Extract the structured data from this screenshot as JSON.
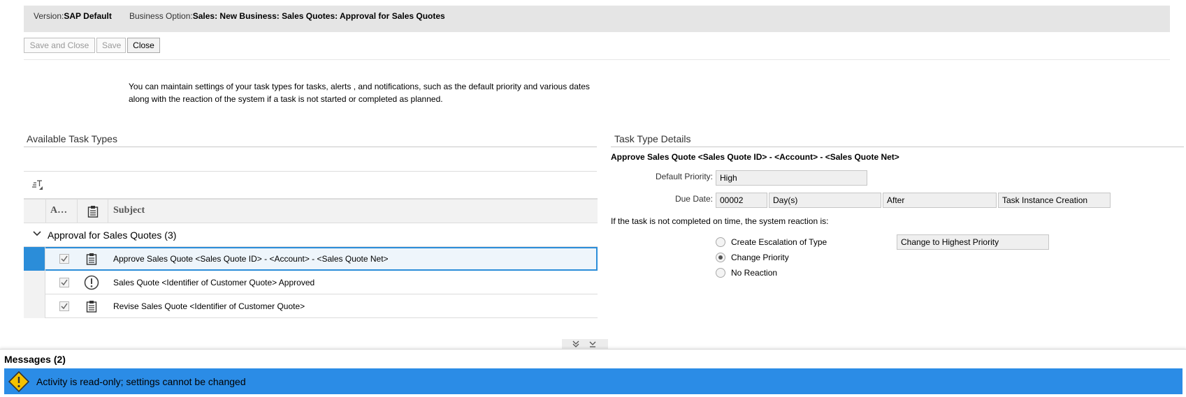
{
  "header": {
    "version_label": "Version:",
    "version_value": "SAP Default",
    "business_option_label": "Business Option:",
    "business_option_value": "Sales: New Business: Sales Quotes: Approval for Sales Quotes"
  },
  "toolbar": {
    "save_and_close": "Save and Close",
    "save": "Save",
    "close": "Close"
  },
  "intro_text": "You can maintain settings of your task types for tasks, alerts , and notifications, such as the default priority and various dates along with the reaction of the system if a task is not started or completed as planned.",
  "available": {
    "title": "Available Task Types",
    "columns": {
      "active": "A…",
      "subject": "Subject"
    },
    "group": "Approval for Sales Quotes (3)",
    "rows": [
      {
        "subject": "Approve Sales Quote <Sales Quote ID> - <Account> - <Sales Quote Net>",
        "icon": "clipboard-icon",
        "checked": true,
        "selected": true
      },
      {
        "subject": "Sales Quote <Identifier of Customer Quote> Approved",
        "icon": "alert-icon",
        "checked": true,
        "selected": false
      },
      {
        "subject": "Revise Sales Quote <Identifier of Customer Quote>",
        "icon": "clipboard-icon",
        "checked": true,
        "selected": false
      }
    ]
  },
  "details": {
    "title": "Task Type Details",
    "subject": "Approve Sales Quote <Sales Quote ID> - <Account> - <Sales Quote Net>",
    "default_priority_label": "Default Priority:",
    "default_priority": "High",
    "due_date_label": "Due Date:",
    "due_date_amount": "00002",
    "due_date_unit": "Day(s)",
    "due_date_relation": "After",
    "due_date_event": "Task Instance Creation",
    "reaction_label": "If the task is not completed on time, the system reaction is:",
    "options": [
      {
        "label": "Create Escalation of Type",
        "selected": false
      },
      {
        "label": "Change Priority",
        "selected": true
      },
      {
        "label": "No Reaction",
        "selected": false
      }
    ],
    "escalation_value": "Change to Highest Priority"
  },
  "messages": {
    "title": "Messages (2)",
    "items": [
      {
        "text": "Activity is read-only; settings cannot be changed",
        "type": "warning"
      }
    ]
  },
  "colors": {
    "selection": "#2b8dd9",
    "message_bar": "#2b8ce6",
    "warning": "#f5c200"
  }
}
